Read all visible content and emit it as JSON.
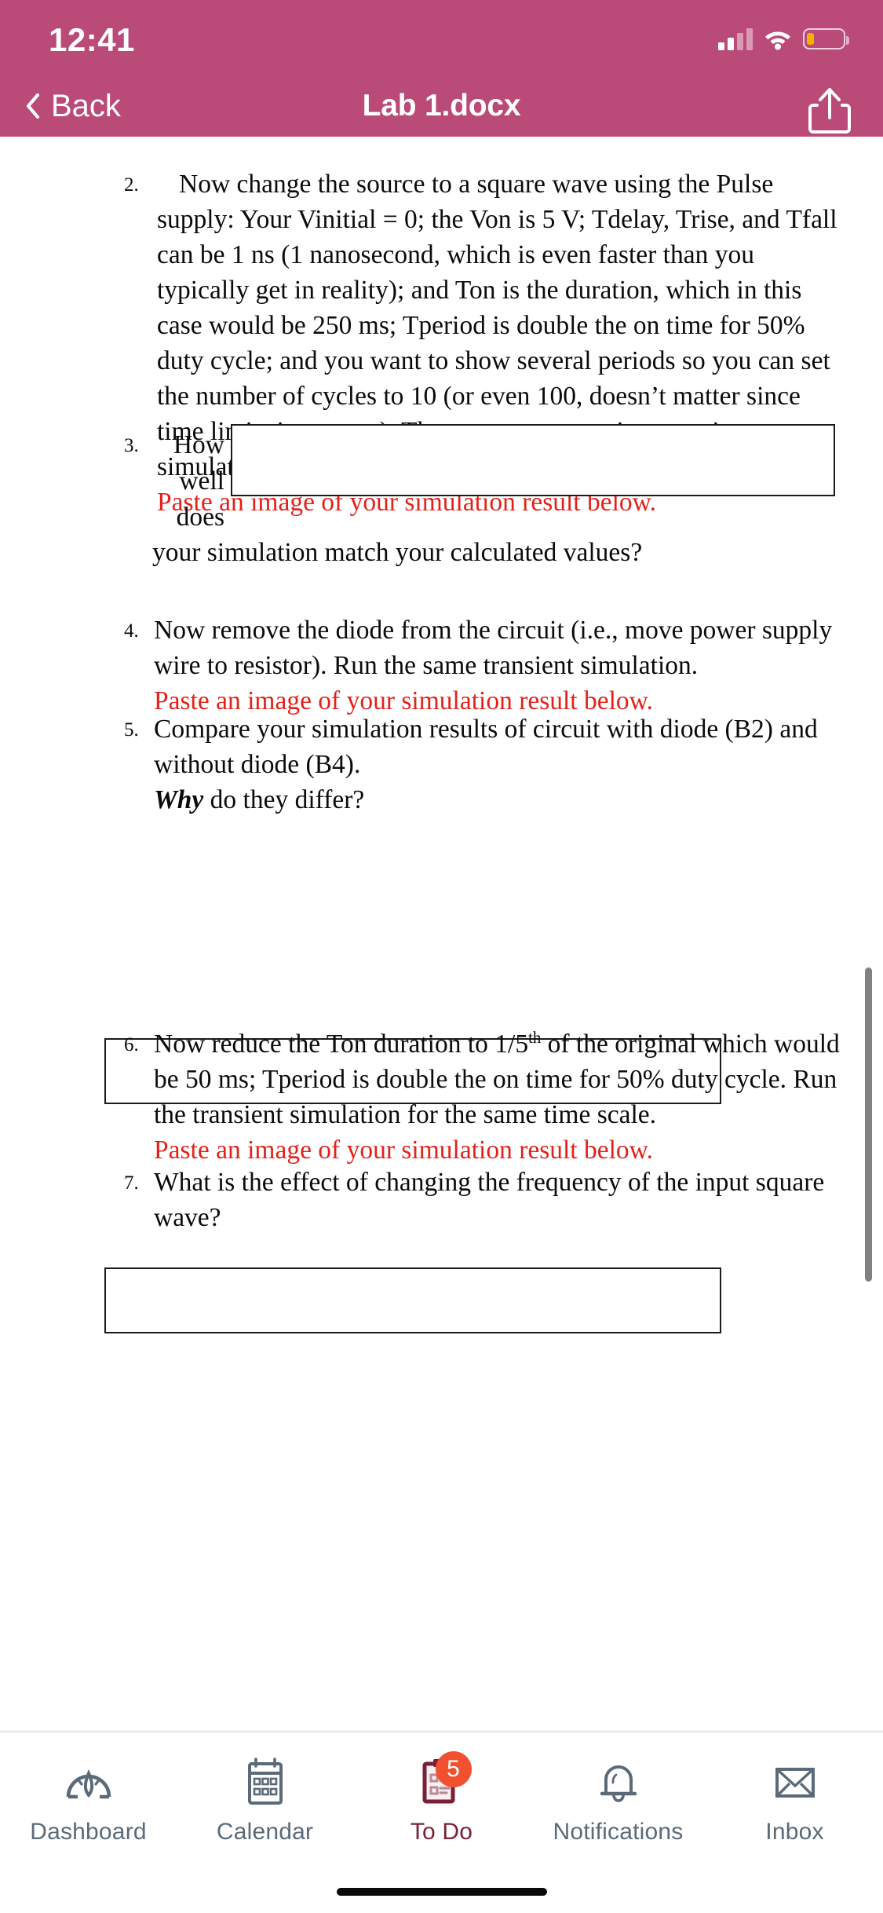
{
  "status_bar": {
    "time": "12:41",
    "signal_icon": "cellular-signal-icon",
    "wifi_icon": "wifi-icon",
    "battery_icon": "battery-low-icon"
  },
  "nav_bar": {
    "back_label": "Back",
    "back_icon": "chevron-left-icon",
    "title": "Lab 1.docx",
    "share_icon": "share-icon",
    "background_color": "#ba4a77"
  },
  "document": {
    "items": [
      {
        "number": "2.",
        "text": "Now change the source to a square wave using the Pulse supply: Your Vinitial = 0; the Von is 5 V; Tdelay, Trise, and Tfall can be 1 ns (1 nanosecond, which is even faster than you typically get in reality); and Ton is the duration, which in this case would be 250 ms; Tperiod is double the on time for 50% duty cycle; and you want to show several periods so you can set the number of cycles to 10 (or even 100, doesn’t matter since time limits it anyway). Then run an appropriate transient simulation to show all the periods.",
        "note": "Paste an image of your simulation result below."
      },
      {
        "number": "3.",
        "wrap_text": "How well does",
        "text": "your simulation match your calculated values?"
      },
      {
        "number": "4.",
        "text": "Now remove the diode from the circuit (i.e., move power supply wire to resistor). Run the same transient simulation.",
        "note": "Paste an image of your simulation result below."
      },
      {
        "number": "5.",
        "text": "Compare your simulation results of circuit with diode (B2) and without diode (B4).",
        "emphasis": "Why",
        "emphasis_rest": " do they differ?"
      },
      {
        "number": "6.",
        "text_before": "Now reduce the Ton duration to 1/5",
        "superscript": "th",
        "text_after": " of the original which would be 50 ms; Tperiod is double the on time for 50% duty cycle. Run the transient simulation for the same time scale.",
        "note": "Paste an image of your simulation result below."
      },
      {
        "number": "7.",
        "text": "What is the effect of changing the frequency of the input square wave?"
      }
    ],
    "answer_boxes": 3,
    "note_color": "#e32119",
    "text_color": "#0b0b0b"
  },
  "tab_bar": {
    "tabs": [
      {
        "label": "Dashboard",
        "icon": "dashboard-gauge-icon",
        "active": false
      },
      {
        "label": "Calendar",
        "icon": "calendar-icon",
        "active": false
      },
      {
        "label": "To Do",
        "icon": "clipboard-todo-icon",
        "active": true,
        "badge": "5"
      },
      {
        "label": "Notifications",
        "icon": "bell-icon",
        "active": false
      },
      {
        "label": "Inbox",
        "icon": "envelope-icon",
        "active": false
      }
    ],
    "active_color": "#7b1f36",
    "inactive_color": "#5b6a78",
    "badge_color": "#f1512e"
  }
}
